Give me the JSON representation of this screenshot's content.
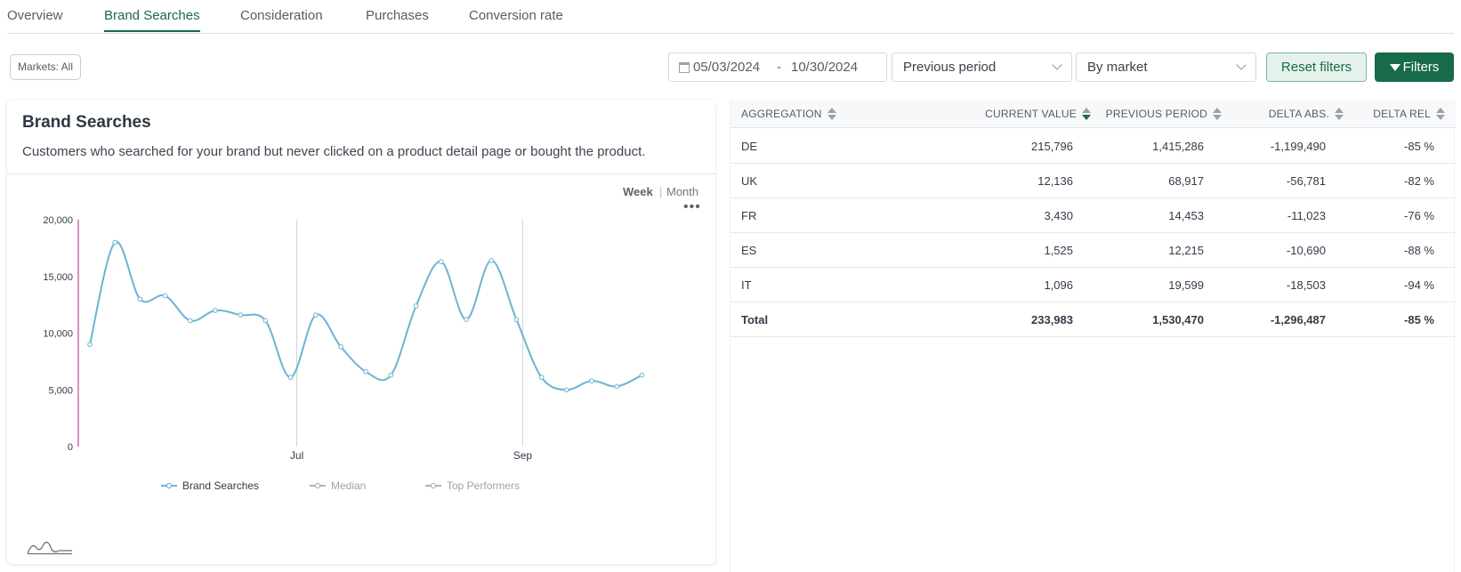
{
  "tabs": [
    {
      "label": "Overview",
      "active": false
    },
    {
      "label": "Brand Searches",
      "active": true
    },
    {
      "label": "Consideration",
      "active": false
    },
    {
      "label": "Purchases",
      "active": false
    },
    {
      "label": "Conversion rate",
      "active": false
    }
  ],
  "filters": {
    "markets_label": "Markets: All",
    "date_start": "05/03/2024",
    "date_separator": "-",
    "date_end": "10/30/2024",
    "comparison": "Previous period",
    "grouping": "By market",
    "reset_label": "Reset filters",
    "filters_label": "Filters"
  },
  "card": {
    "title": "Brand Searches",
    "subtitle": "Customers who searched for your brand but never clicked on a product detail page or bought the product.",
    "granularity": {
      "week": "Week",
      "separator": "|",
      "month": "Month",
      "selected": "Week"
    },
    "more_icon": "ellipsis-icon",
    "footer_icon": "chart-distribution-icon"
  },
  "chart_data": {
    "type": "line",
    "ylim": [
      0,
      20000
    ],
    "yticks": [
      "20,000",
      "15,000",
      "10,000",
      "5,000",
      "0"
    ],
    "ytick_values": [
      20000,
      15000,
      10000,
      5000,
      0
    ],
    "xtick_labels": [
      {
        "label": "Jul",
        "index": 8
      },
      {
        "label": "Sep",
        "index": 17
      }
    ],
    "series": [
      {
        "name": "Brand Searches",
        "color": "#6ab4d2",
        "values": [
          9000,
          18000,
          13000,
          13300,
          11100,
          12000,
          11600,
          11100,
          6100,
          11600,
          8800,
          6600,
          6300,
          12400,
          16300,
          11200,
          16400,
          11200,
          6100,
          5000,
          5800,
          5300,
          6300
        ]
      }
    ],
    "legend": [
      {
        "label": "Brand Searches",
        "color": "#6ab4d2",
        "active": true
      },
      {
        "label": "Median",
        "color": "#b3b3b3",
        "active": false
      },
      {
        "label": "Top Performers",
        "color": "#b3b3b3",
        "active": false
      }
    ],
    "legend_position": "bottom",
    "grid": false
  },
  "table": {
    "headers": [
      "AGGREGATION",
      "CURRENT VALUE",
      "PREVIOUS PERIOD",
      "DELTA ABS.",
      "DELTA REL"
    ],
    "sorted_column": "CURRENT VALUE",
    "rows": [
      {
        "aggregation": "DE",
        "current": "215,796",
        "previous": "1,415,286",
        "delta_abs": "-1,199,490",
        "delta_rel": "-85 %"
      },
      {
        "aggregation": "UK",
        "current": "12,136",
        "previous": "68,917",
        "delta_abs": "-56,781",
        "delta_rel": "-82 %"
      },
      {
        "aggregation": "FR",
        "current": "3,430",
        "previous": "14,453",
        "delta_abs": "-11,023",
        "delta_rel": "-76 %"
      },
      {
        "aggregation": "ES",
        "current": "1,525",
        "previous": "12,215",
        "delta_abs": "-10,690",
        "delta_rel": "-88 %"
      },
      {
        "aggregation": "IT",
        "current": "1,096",
        "previous": "19,599",
        "delta_abs": "-18,503",
        "delta_rel": "-94 %"
      }
    ],
    "total": {
      "aggregation": "Total",
      "current": "233,983",
      "previous": "1,530,470",
      "delta_abs": "-1,296,487",
      "delta_rel": "-85 %"
    }
  },
  "colors": {
    "accent": "#176b4a",
    "accent_light": "#e5f2eb",
    "series": "#6ab4d2",
    "y_axis_marker": "#c2187f"
  }
}
